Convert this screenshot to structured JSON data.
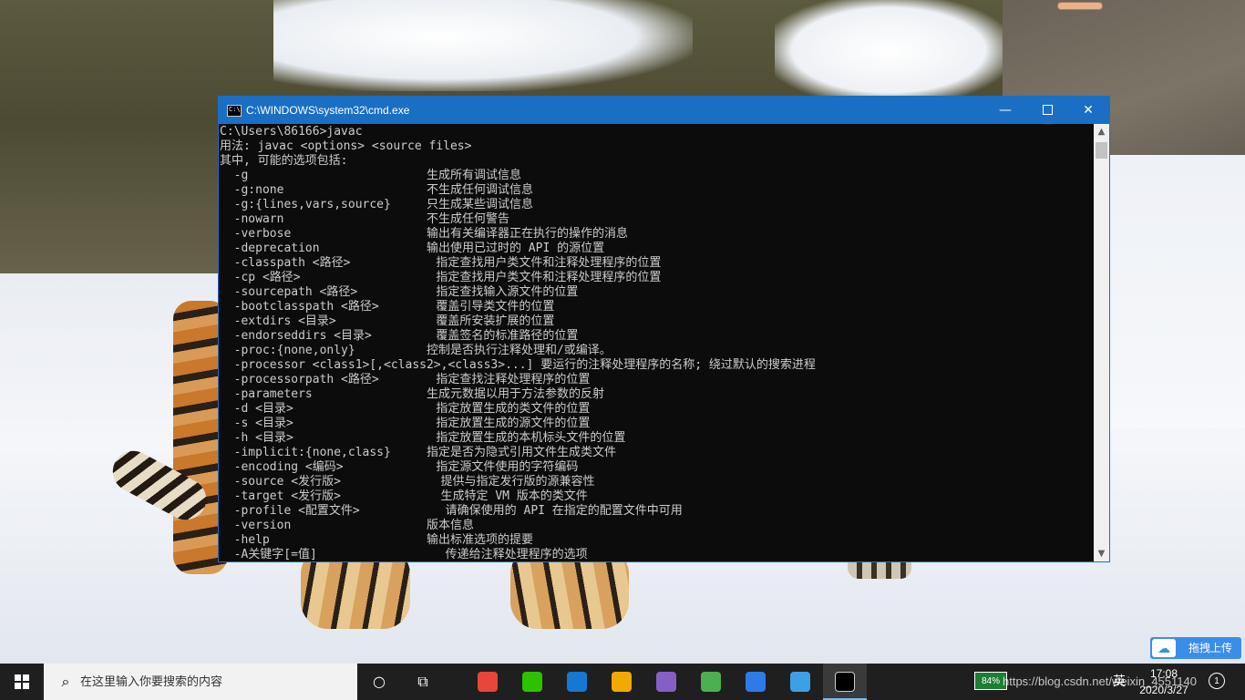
{
  "window": {
    "title": "C:\\WINDOWS\\system32\\cmd.exe",
    "minimize_glyph": "—",
    "close_glyph": "✕"
  },
  "console_lines": [
    "C:\\Users\\86166>javac",
    "用法: javac <options> <source files>",
    "其中, 可能的选项包括:",
    "  -g                         生成所有调试信息",
    "  -g:none                    不生成任何调试信息",
    "  -g:{lines,vars,source}     只生成某些调试信息",
    "  -nowarn                    不生成任何警告",
    "  -verbose                   输出有关编译器正在执行的操作的消息",
    "  -deprecation               输出使用已过时的 API 的源位置",
    "  -classpath <路径>            指定查找用户类文件和注释处理程序的位置",
    "  -cp <路径>                   指定查找用户类文件和注释处理程序的位置",
    "  -sourcepath <路径>           指定查找输入源文件的位置",
    "  -bootclasspath <路径>        覆盖引导类文件的位置",
    "  -extdirs <目录>              覆盖所安装扩展的位置",
    "  -endorseddirs <目录>         覆盖签名的标准路径的位置",
    "  -proc:{none,only}          控制是否执行注释处理和/或编译。",
    "  -processor <class1>[,<class2>,<class3>...] 要运行的注释处理程序的名称; 绕过默认的搜索进程",
    "  -processorpath <路径>        指定查找注释处理程序的位置",
    "  -parameters                生成元数据以用于方法参数的反射",
    "  -d <目录>                    指定放置生成的类文件的位置",
    "  -s <目录>                    指定放置生成的源文件的位置",
    "  -h <目录>                    指定放置生成的本机标头文件的位置",
    "  -implicit:{none,class}     指定是否为隐式引用文件生成类文件",
    "  -encoding <编码>             指定源文件使用的字符编码",
    "  -source <发行版>              提供与指定发行版的源兼容性",
    "  -target <发行版>              生成特定 VM 版本的类文件",
    "  -profile <配置文件>            请确保使用的 API 在指定的配置文件中可用",
    "  -version                   版本信息",
    "  -help                      输出标准选项的提要",
    "  -A关键字[=值]                  传递给注释处理程序的选项"
  ],
  "scrollbar": {
    "up_glyph": "▲",
    "down_glyph": "▼"
  },
  "upload_widget": {
    "icon_glyph": "☁",
    "label": "拖拽上传"
  },
  "taskbar": {
    "search_glyph": "⌕",
    "search_placeholder": "在这里输入你要搜索的内容",
    "task_view_glyph": "○",
    "timeline_glyph": "⧉",
    "apps": [
      {
        "name": "chrome",
        "color": "#e8453c"
      },
      {
        "name": "wechat",
        "color": "#2dc100"
      },
      {
        "name": "app-star",
        "color": "#1478d4"
      },
      {
        "name": "app-frame",
        "color": "#f2a900"
      },
      {
        "name": "visual-studio",
        "color": "#865fc5"
      },
      {
        "name": "app-chart",
        "color": "#4caf50"
      },
      {
        "name": "app-baidu",
        "color": "#2e7be8"
      },
      {
        "name": "app-window",
        "color": "#3ca0e8"
      },
      {
        "name": "cmd",
        "color": "#000000"
      }
    ],
    "tray_badge": "84%",
    "tray_url": "https://blog.csdn.net/weixin_4551140",
    "ime": "英",
    "time": "17:08",
    "date": "2020/3/27",
    "notification_count": "1"
  }
}
